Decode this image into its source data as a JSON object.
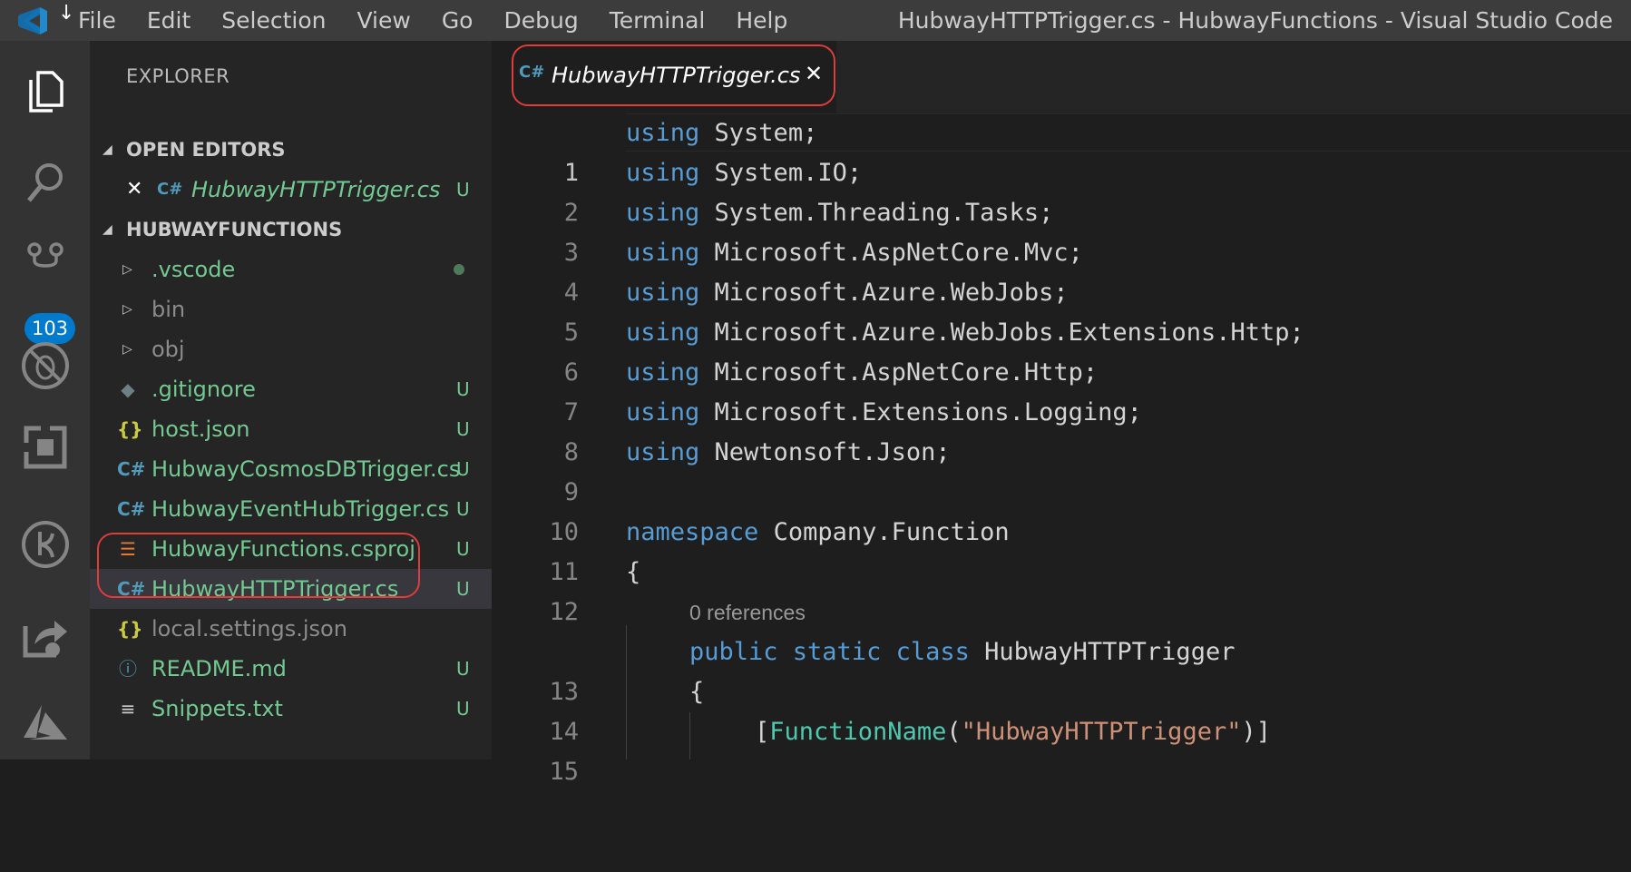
{
  "titlebar": {
    "menu": [
      "File",
      "Edit",
      "Selection",
      "View",
      "Go",
      "Debug",
      "Terminal",
      "Help"
    ],
    "window_title": "HubwayHTTPTrigger.cs - HubwayFunctions - Visual Studio Code"
  },
  "activitybar": {
    "items": [
      "explorer-icon",
      "search-icon",
      "source-control-icon",
      "debug-icon",
      "extensions-icon",
      "remote-icon",
      "live-share-icon",
      "azure-icon"
    ],
    "scm_badge": "103"
  },
  "sidebar": {
    "title": "EXPLORER",
    "open_editors": {
      "header": "OPEN EDITORS",
      "items": [
        {
          "name": "HubwayHTTPTrigger.cs",
          "status": "U"
        }
      ]
    },
    "project": {
      "header": "HUBWAYFUNCTIONS",
      "items": [
        {
          "name": ".vscode",
          "status": ""
        },
        {
          "name": "bin",
          "status": ""
        },
        {
          "name": "obj",
          "status": ""
        },
        {
          "name": ".gitignore",
          "status": "U"
        },
        {
          "name": "host.json",
          "status": "U"
        },
        {
          "name": "HubwayCosmosDBTrigger.cs",
          "status": "U"
        },
        {
          "name": "HubwayEventHubTrigger.cs",
          "status": "U"
        },
        {
          "name": "HubwayFunctions.csproj",
          "status": "U"
        },
        {
          "name": "HubwayHTTPTrigger.cs",
          "status": "U"
        },
        {
          "name": "local.settings.json",
          "status": ""
        },
        {
          "name": "README.md",
          "status": "U"
        },
        {
          "name": "Snippets.txt",
          "status": "U"
        }
      ]
    }
  },
  "editor": {
    "tab": {
      "label": "HubwayHTTPTrigger.cs",
      "icon": "C#"
    },
    "line_numbers": [
      "1",
      "2",
      "3",
      "4",
      "5",
      "6",
      "7",
      "8",
      "9",
      "10",
      "11",
      "12",
      "13",
      "14",
      "15"
    ],
    "lines": [
      {
        "kw": "using",
        "rest": " System;"
      },
      {
        "kw": "using",
        "rest": " System.IO;"
      },
      {
        "kw": "using",
        "rest": " System.Threading.Tasks;"
      },
      {
        "kw": "using",
        "rest": " Microsoft.AspNetCore.Mvc;"
      },
      {
        "kw": "using",
        "rest": " Microsoft.Azure.WebJobs;"
      },
      {
        "kw": "using",
        "rest": " Microsoft.Azure.WebJobs.Extensions.Http;"
      },
      {
        "kw": "using",
        "rest": " Microsoft.AspNetCore.Http;"
      },
      {
        "kw": "using",
        "rest": " Microsoft.Extensions.Logging;"
      },
      {
        "kw": "using",
        "rest": " Newtonsoft.Json;"
      },
      {
        "kw": "",
        "rest": ""
      },
      {
        "kw": "namespace",
        "rest": " Company.Function"
      },
      {
        "kw": "",
        "rest": "{"
      },
      {
        "kw": "public static class",
        "rest": " HubwayHTTPTrigger"
      },
      {
        "kw": "",
        "rest": "{"
      },
      {
        "kw": "",
        "rest": "[FunctionName(\"HubwayHTTPTrigger\")]"
      }
    ],
    "codelens": "0 references",
    "attr_name": "FunctionName",
    "attr_string": "\"HubwayHTTPTrigger\""
  },
  "colors": {
    "accent": "#007acc",
    "highlight_box": "#e03c3c",
    "untracked": "#73c991"
  }
}
